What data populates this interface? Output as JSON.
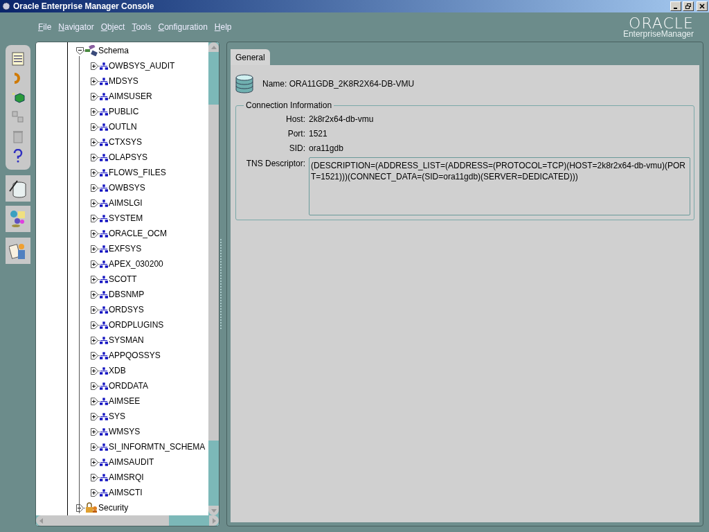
{
  "window": {
    "title": "Oracle Enterprise Manager Console"
  },
  "menu": [
    {
      "label": "File"
    },
    {
      "label": "Navigator"
    },
    {
      "label": "Object"
    },
    {
      "label": "Tools"
    },
    {
      "label": "Configuration"
    },
    {
      "label": "Help"
    }
  ],
  "logo": {
    "brand": "ORACLE",
    "product": "EnterpriseManager"
  },
  "tree": [
    {
      "label": "Schema",
      "kind": "folder",
      "expanded": true,
      "children": [
        {
          "label": "OWBSYS_AUDIT",
          "kind": "user",
          "expanded": false
        },
        {
          "label": "MDSYS",
          "kind": "user",
          "expanded": false
        },
        {
          "label": "AIMSUSER",
          "kind": "user",
          "expanded": false
        },
        {
          "label": "PUBLIC",
          "kind": "user",
          "expanded": false
        },
        {
          "label": "OUTLN",
          "kind": "user",
          "expanded": false
        },
        {
          "label": "CTXSYS",
          "kind": "user",
          "expanded": false
        },
        {
          "label": "OLAPSYS",
          "kind": "user",
          "expanded": false
        },
        {
          "label": "FLOWS_FILES",
          "kind": "user",
          "expanded": false
        },
        {
          "label": "OWBSYS",
          "kind": "user",
          "expanded": false
        },
        {
          "label": "AIMSLGI",
          "kind": "user",
          "expanded": false
        },
        {
          "label": "SYSTEM",
          "kind": "user",
          "expanded": false
        },
        {
          "label": "ORACLE_OCM",
          "kind": "user",
          "expanded": false
        },
        {
          "label": "EXFSYS",
          "kind": "user",
          "expanded": false
        },
        {
          "label": "APEX_030200",
          "kind": "user",
          "expanded": false
        },
        {
          "label": "SCOTT",
          "kind": "user",
          "expanded": false
        },
        {
          "label": "DBSNMP",
          "kind": "user",
          "expanded": false
        },
        {
          "label": "ORDSYS",
          "kind": "user",
          "expanded": false
        },
        {
          "label": "ORDPLUGINS",
          "kind": "user",
          "expanded": false
        },
        {
          "label": "SYSMAN",
          "kind": "user",
          "expanded": false
        },
        {
          "label": "APPQOSSYS",
          "kind": "user",
          "expanded": false
        },
        {
          "label": "XDB",
          "kind": "user",
          "expanded": false
        },
        {
          "label": "ORDDATA",
          "kind": "user",
          "expanded": false
        },
        {
          "label": "AIMSEE",
          "kind": "user",
          "expanded": false
        },
        {
          "label": "SYS",
          "kind": "user",
          "expanded": false
        },
        {
          "label": "WMSYS",
          "kind": "user",
          "expanded": false
        },
        {
          "label": "SI_INFORMTN_SCHEMA",
          "kind": "user",
          "expanded": false
        },
        {
          "label": "AIMSAUDIT",
          "kind": "user",
          "expanded": false
        },
        {
          "label": "AIMSRQI",
          "kind": "user",
          "expanded": false
        },
        {
          "label": "AIMSCTI",
          "kind": "user",
          "expanded": false
        }
      ]
    },
    {
      "label": "Security",
      "kind": "security",
      "expanded": false
    }
  ],
  "tabs": [
    {
      "label": "General",
      "selected": true
    }
  ],
  "detail": {
    "name": "Name: ORA11GDB_2K8R2X64-DB-VMU",
    "group_title": "Connection Information",
    "fields": [
      {
        "label": "Host:",
        "value": "2k8r2x64-db-vmu"
      },
      {
        "label": "Port:",
        "value": "1521"
      },
      {
        "label": "SID:",
        "value": "ora11gdb"
      }
    ],
    "tns": {
      "label": "TNS Descriptor:",
      "value": "(DESCRIPTION=(ADDRESS_LIST=(ADDRESS=(PROTOCOL=TCP)(HOST=2k8r2x64-db-vmu)(PORT=1521)))(CONNECT_DATA=(SID=ora11gdb)(SERVER=DEDICATED)))"
    }
  }
}
